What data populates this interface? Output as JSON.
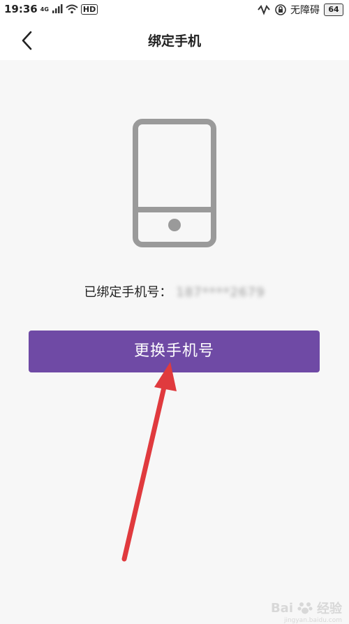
{
  "status_bar": {
    "time": "19:36",
    "network_label": "4G",
    "hd_label": "HD",
    "no_obstacle_label": "无障碍",
    "battery_level": "64"
  },
  "nav": {
    "title": "绑定手机"
  },
  "main": {
    "bound_label": "已绑定手机号：",
    "bound_number": "187****2679",
    "change_button_label": "更换手机号"
  },
  "watermark": {
    "brand": "Bai",
    "brand_suffix": "经验",
    "url": "jingyan.baidu.com"
  },
  "colors": {
    "accent": "#6f4aa5",
    "annotation_arrow": "#e03a3e",
    "icon_gray": "#9a9a9a"
  }
}
